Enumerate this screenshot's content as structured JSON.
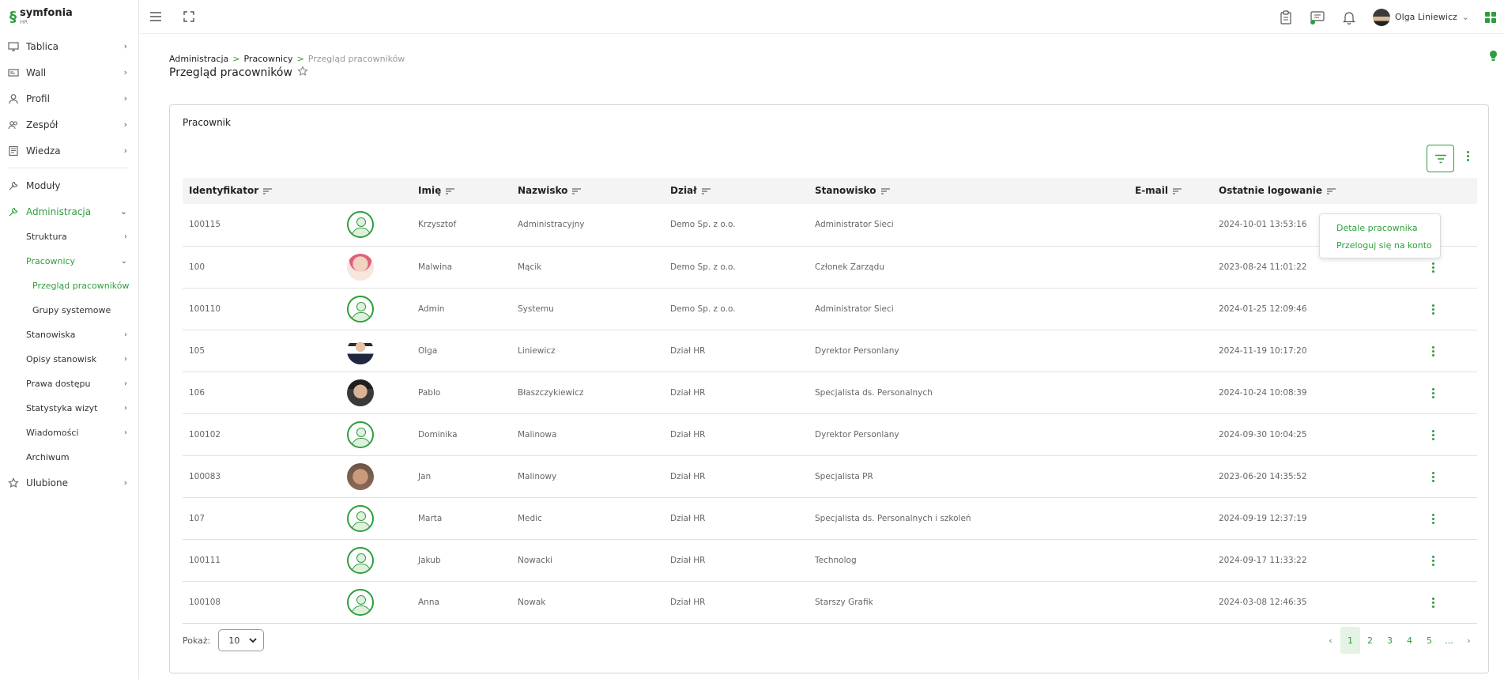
{
  "app": {
    "logo_name": "symfonia",
    "logo_sub": "HR"
  },
  "sidebar": {
    "items": [
      {
        "label": "Tablica"
      },
      {
        "label": "Wall"
      },
      {
        "label": "Profil"
      },
      {
        "label": "Zespół"
      },
      {
        "label": "Wiedza"
      },
      {
        "label": "Moduły"
      },
      {
        "label": "Administracja"
      },
      {
        "label": "Ulubione"
      }
    ],
    "admin_sub": [
      {
        "label": "Struktura"
      },
      {
        "label": "Pracownicy"
      },
      {
        "label": "Stanowiska"
      },
      {
        "label": "Opisy stanowisk"
      },
      {
        "label": "Prawa dostępu"
      },
      {
        "label": "Statystyka wizyt"
      },
      {
        "label": "Wiadomości"
      },
      {
        "label": "Archiwum"
      }
    ],
    "pracownicy_sub": [
      {
        "label": "Przegląd pracowników"
      },
      {
        "label": "Grupy systemowe"
      }
    ]
  },
  "topbar": {
    "user_name": "Olga Liniewicz"
  },
  "breadcrumb": {
    "b1": "Administracja",
    "b2": "Pracownicy",
    "b3": "Przegląd pracowników",
    "sep": ">"
  },
  "page_title": "Przegląd pracowników",
  "card": {
    "title": "Pracownik"
  },
  "table": {
    "headers": {
      "id": "Identyfikator",
      "first": "Imię",
      "last": "Nazwisko",
      "dept": "Dział",
      "pos": "Stanowisko",
      "email": "E-mail",
      "login": "Ostatnie logowanie"
    },
    "rows": [
      {
        "id": "100115",
        "first": "Krzysztof",
        "last": "Administracyjny",
        "dept": "Demo Sp. z o.o.",
        "pos": "Administrator Sieci",
        "email": "",
        "login": "2024-10-01 13:53:16"
      },
      {
        "id": "100",
        "first": "Malwina",
        "last": "Mącik",
        "dept": "Demo Sp. z o.o.",
        "pos": "Członek Zarządu",
        "email": "",
        "login": "2023-08-24 11:01:22"
      },
      {
        "id": "100110",
        "first": "Admin",
        "last": "Systemu",
        "dept": "Demo Sp. z o.o.",
        "pos": "Administrator Sieci",
        "email": "",
        "login": "2024-01-25 12:09:46"
      },
      {
        "id": "105",
        "first": "Olga",
        "last": "Liniewicz",
        "dept": "Dział HR",
        "pos": "Dyrektor Personlany",
        "email": "",
        "login": "2024-11-19 10:17:20"
      },
      {
        "id": "106",
        "first": "Pablo",
        "last": "Błaszczykiewicz",
        "dept": "Dział HR",
        "pos": "Specjalista ds. Personalnych",
        "email": "",
        "login": "2024-10-24 10:08:39"
      },
      {
        "id": "100102",
        "first": "Dominika",
        "last": "Malinowa",
        "dept": "Dział HR",
        "pos": "Dyrektor Personlany",
        "email": "",
        "login": "2024-09-30 10:04:25"
      },
      {
        "id": "100083",
        "first": "Jan",
        "last": "Malinowy",
        "dept": "Dział HR",
        "pos": "Specjalista PR",
        "email": "",
        "login": "2023-06-20 14:35:52"
      },
      {
        "id": "107",
        "first": "Marta",
        "last": "Medic",
        "dept": "Dział HR",
        "pos": "Specjalista ds. Personalnych i szkoleń",
        "email": "",
        "login": "2024-09-19 12:37:19"
      },
      {
        "id": "100111",
        "first": "Jakub",
        "last": "Nowacki",
        "dept": "Dział HR",
        "pos": "Technolog",
        "email": "",
        "login": "2024-09-17 11:33:22"
      },
      {
        "id": "100108",
        "first": "Anna",
        "last": "Nowak",
        "dept": "Dział HR",
        "pos": "Starszy Grafik",
        "email": "",
        "login": "2024-03-08 12:46:35"
      }
    ]
  },
  "context_menu": {
    "item1": "Detale pracownika",
    "item2": "Przeloguj się na konto"
  },
  "footer": {
    "show_label": "Pokaż:",
    "page_size": "10"
  },
  "pagination": {
    "prev": "‹",
    "pages": [
      "1",
      "2",
      "3",
      "4",
      "5"
    ],
    "ellipsis": "...",
    "next": "›",
    "current": "1"
  },
  "colors": {
    "accent": "#2e9e3c"
  }
}
